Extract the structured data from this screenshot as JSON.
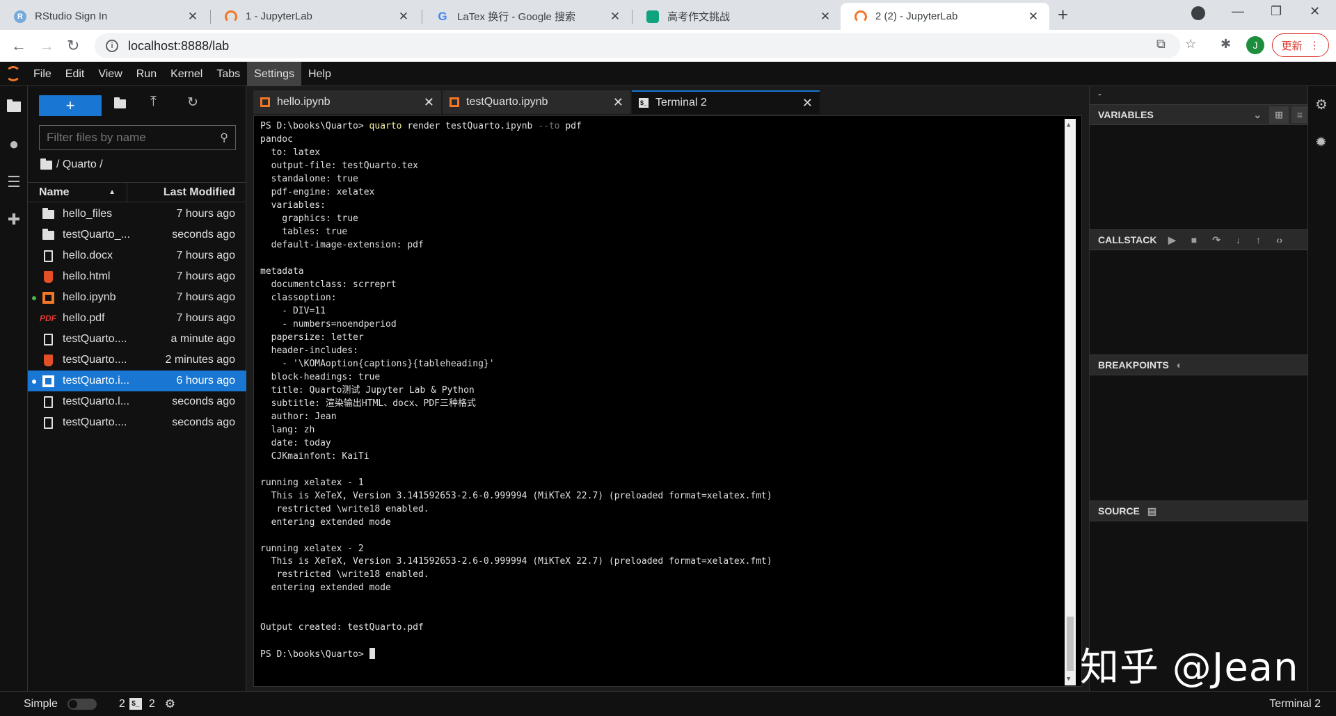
{
  "browser": {
    "tabs": [
      {
        "title": "RStudio Sign In",
        "icon": "rstudio-icon"
      },
      {
        "title": "1 - JupyterLab",
        "icon": "jupyter-icon"
      },
      {
        "title": "LaTex 换行 - Google 搜索",
        "icon": "google-icon"
      },
      {
        "title": "高考作文挑战",
        "icon": "chatgpt-icon"
      },
      {
        "title": "2 (2) - JupyterLab",
        "icon": "jupyter-icon",
        "active": true
      }
    ],
    "url": "localhost:8888/lab",
    "account_initial": "J",
    "update_label": "更新"
  },
  "menubar": {
    "items": [
      "File",
      "Edit",
      "View",
      "Run",
      "Kernel",
      "Tabs",
      "Settings",
      "Help"
    ],
    "selected": "Settings"
  },
  "filebrowser": {
    "new_button_label": "+",
    "filter_placeholder": "Filter files by name",
    "breadcrumb": "/ Quarto /",
    "col_name": "Name",
    "col_modified": "Last Modified",
    "files": [
      {
        "name": "hello_files",
        "type": "folder",
        "modified": "7 hours ago"
      },
      {
        "name": "testQuarto_...",
        "type": "folder",
        "modified": "seconds ago"
      },
      {
        "name": "hello.docx",
        "type": "doc",
        "modified": "7 hours ago"
      },
      {
        "name": "hello.html",
        "type": "html",
        "modified": "7 hours ago"
      },
      {
        "name": "hello.ipynb",
        "type": "notebook",
        "modified": "7 hours ago",
        "running": true
      },
      {
        "name": "hello.pdf",
        "type": "pdf",
        "modified": "7 hours ago"
      },
      {
        "name": "testQuarto....",
        "type": "doc",
        "modified": "a minute ago"
      },
      {
        "name": "testQuarto....",
        "type": "html",
        "modified": "2 minutes ago"
      },
      {
        "name": "testQuarto.i...",
        "type": "notebook",
        "modified": "6 hours ago",
        "selected": true,
        "running": true
      },
      {
        "name": "testQuarto.l...",
        "type": "doc",
        "modified": "seconds ago"
      },
      {
        "name": "testQuarto....",
        "type": "doc",
        "modified": "seconds ago"
      }
    ]
  },
  "dock": {
    "tabs": [
      {
        "title": "hello.ipynb",
        "icon": "notebook-icon"
      },
      {
        "title": "testQuarto.ipynb",
        "icon": "notebook-icon"
      },
      {
        "title": "Terminal 2",
        "icon": "terminal-icon",
        "active": true
      }
    ]
  },
  "terminal": {
    "prompt": "PS D:\\books\\Quarto> ",
    "command": "quarto",
    "command_args": " render testQuarto.ipynb ",
    "command_flag": "--to",
    "command_tail": " pdf",
    "output": "pandoc\n  to: latex\n  output-file: testQuarto.tex\n  standalone: true\n  pdf-engine: xelatex\n  variables:\n    graphics: true\n    tables: true\n  default-image-extension: pdf\n\nmetadata\n  documentclass: scrreprt\n  classoption:\n    - DIV=11\n    - numbers=noendperiod\n  papersize: letter\n  header-includes:\n    - '\\KOMAoption{captions}{tableheading}'\n  block-headings: true\n  title: Quarto测试 Jupyter Lab & Python\n  subtitle: 渲染输出HTML、docx、PDF三种格式\n  author: Jean\n  lang: zh\n  date: today\n  CJKmainfont: KaiTi\n\nrunning xelatex - 1\n  This is XeTeX, Version 3.141592653-2.6-0.999994 (MiKTeX 22.7) (preloaded format=xelatex.fmt)\n   restricted \\write18 enabled.\n  entering extended mode\n\nrunning xelatex - 2\n  This is XeTeX, Version 3.141592653-2.6-0.999994 (MiKTeX 22.7) (preloaded format=xelatex.fmt)\n   restricted \\write18 enabled.\n  entering extended mode\n\n\nOutput created: testQuarto.pdf\n",
    "final_prompt": "PS D:\\books\\Quarto> "
  },
  "debugger": {
    "top_label": "-",
    "variables": "VARIABLES",
    "callstack": "CALLSTACK",
    "breakpoints": "BREAKPOINTS",
    "source": "SOURCE"
  },
  "statusbar": {
    "mode_label": "Simple",
    "kernels_count": "2",
    "terminals_count": "2",
    "right_label": "Terminal 2"
  },
  "watermark": "知乎 @Jean",
  "colors": {
    "accent": "#1976d2",
    "jupyter_orange": "#f37726",
    "command_yellow": "#f9f1a5"
  }
}
